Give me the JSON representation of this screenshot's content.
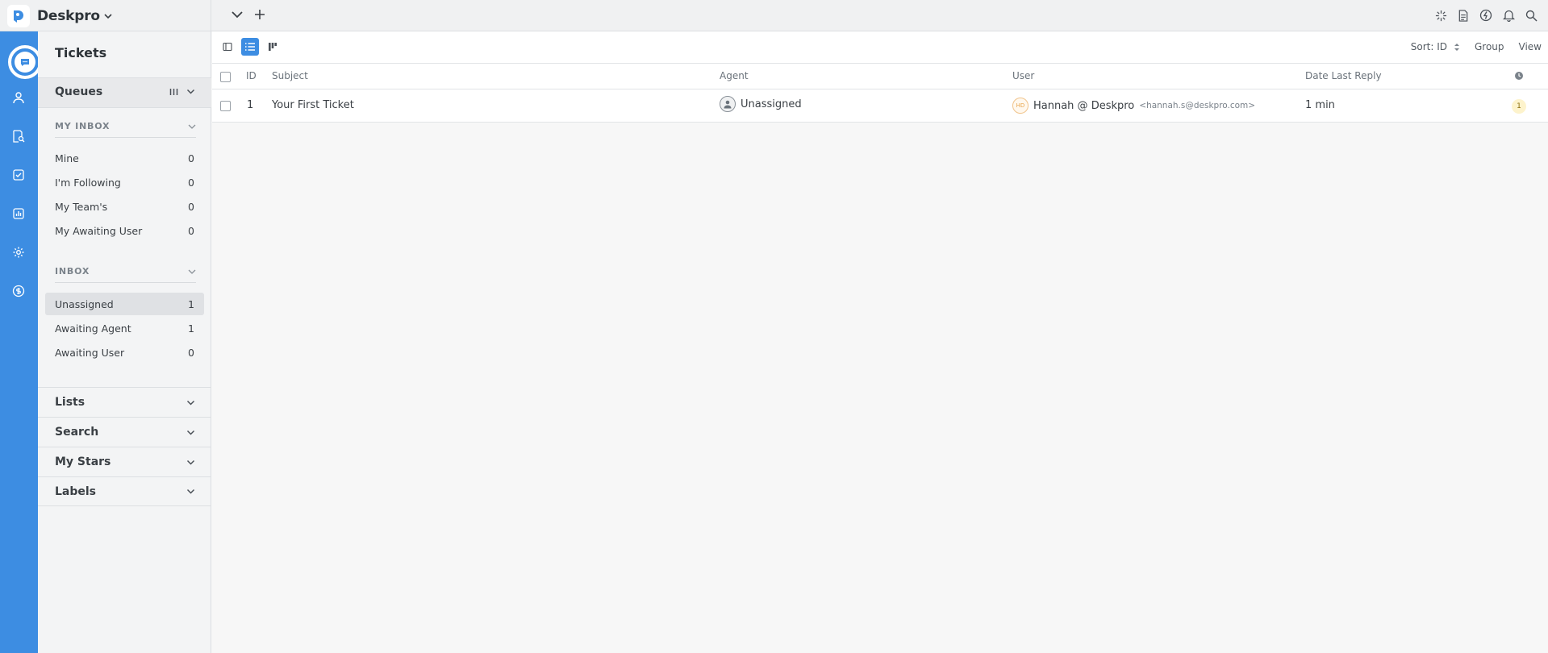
{
  "app": {
    "name": "Deskpro"
  },
  "colors": {
    "accent": "#3d8de2",
    "rail": "#3d8de2",
    "badge": "#fdf3cc"
  },
  "rail": {
    "items": [
      "tickets-icon",
      "users-icon",
      "knowledge-search-icon",
      "tasks-icon",
      "reports-icon",
      "settings-icon",
      "billing-icon"
    ]
  },
  "sidebar": {
    "title": "Tickets",
    "queues_label": "Queues",
    "my_inbox": {
      "label": "MY INBOX",
      "items": [
        {
          "label": "Mine",
          "count": "0"
        },
        {
          "label": "I'm Following",
          "count": "0"
        },
        {
          "label": "My Team's",
          "count": "0"
        },
        {
          "label": "My Awaiting User",
          "count": "0"
        }
      ]
    },
    "inbox": {
      "label": "INBOX",
      "items": [
        {
          "label": "Unassigned",
          "count": "1"
        },
        {
          "label": "Awaiting Agent",
          "count": "1"
        },
        {
          "label": "Awaiting User",
          "count": "0"
        }
      ]
    },
    "sections": [
      "Lists",
      "Search",
      "My Stars",
      "Labels"
    ]
  },
  "toolbar": {
    "sort_label": "Sort: ID",
    "group_label": "Group",
    "view_label": "View"
  },
  "table": {
    "columns": {
      "id": "ID",
      "subject": "Subject",
      "agent": "Agent",
      "user": "User",
      "date": "Date Last Reply"
    },
    "rows": [
      {
        "id": "1",
        "subject": "Your First Ticket",
        "agent": "Unassigned",
        "user_initials": "HD",
        "user_name": "Hannah @ Deskpro",
        "user_email": "<hannah.s@deskpro.com>",
        "date": "1 min",
        "count": "1"
      }
    ]
  }
}
